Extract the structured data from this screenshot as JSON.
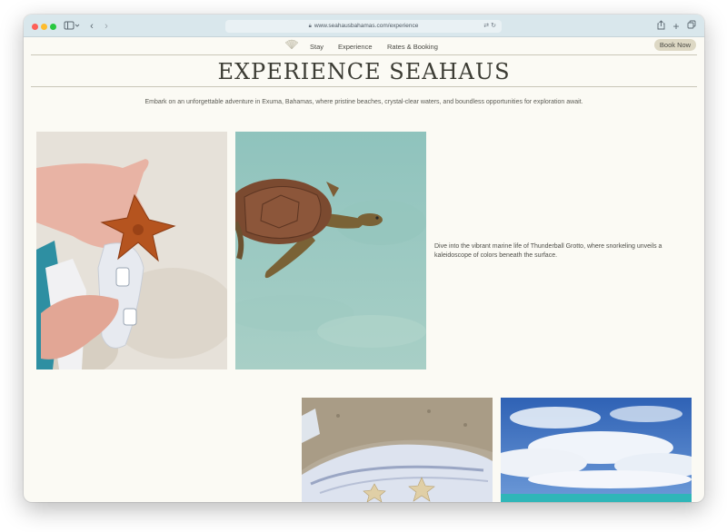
{
  "browser": {
    "url": "www.seahausbahamas.com/experience",
    "colors": {
      "toolbar": "#d9e7ec"
    }
  },
  "nav": {
    "links": [
      "Stay",
      "Experience",
      "Rates & Booking"
    ],
    "book_label": "Book Now"
  },
  "page": {
    "title": "EXPERIENCE SEAHAUS",
    "intro": "Embark on an unforgettable adventure in Exuma, Bahamas, where pristine beaches, crystal-clear waters, and boundless opportunities for exploration await.",
    "caption": "Dive into the vibrant marine life of Thunderball Grotto, where snorkeling unveils a kaleidoscope of colors beneath the surface."
  },
  "icons": [
    "sidebar-icon",
    "back-icon",
    "forward-icon",
    "lock-icon",
    "translate-icon",
    "reload-icon",
    "share-icon",
    "new-tab-icon",
    "tabs-icon",
    "shell-logo-icon"
  ],
  "theme": {
    "background": "#fbfaf4",
    "text": "#3c3c34",
    "button": "#ddd8c4"
  }
}
